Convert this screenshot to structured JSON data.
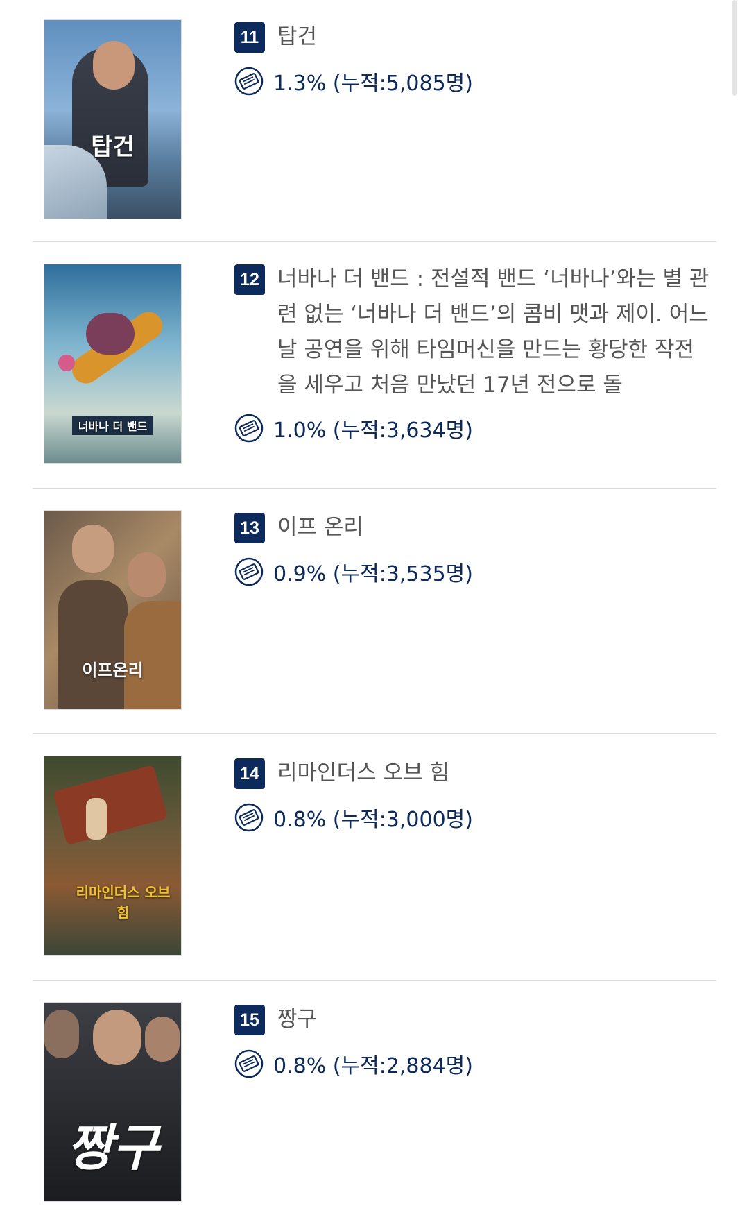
{
  "items": [
    {
      "rank": "11",
      "title": "탑건",
      "share": "1.3%",
      "cumulative": "(누적:5,085명)",
      "poster_text": "탑건"
    },
    {
      "rank": "12",
      "title": "너바나 더 밴드 : 전설적 밴드 ‘너바나’와는 별 관련 없는 ‘너바나 더 밴드’의 콤비 맷과 제이. 어느 날 공연을 위해 타임머신을 만드는 황당한 작전을 세우고 처음 만났던 17년 전으로 돌",
      "share": "1.0%",
      "cumulative": "(누적:3,634명)",
      "poster_text": "너바나 더 밴드"
    },
    {
      "rank": "13",
      "title": "이프 온리",
      "share": "0.9%",
      "cumulative": "(누적:3,535명)",
      "poster_text": "이프온리"
    },
    {
      "rank": "14",
      "title": "리마인더스 오브 힘",
      "share": "0.8%",
      "cumulative": "(누적:3,000명)",
      "poster_text": "리마인더스 오브 힘"
    },
    {
      "rank": "15",
      "title": "짱구",
      "share": "0.8%",
      "cumulative": "(누적:2,884명)",
      "poster_text": "짱구"
    }
  ],
  "icons": {
    "ticket": "ticket-icon"
  },
  "colors": {
    "rank_badge": "#0c2a5b",
    "stat_text": "#0c2a5b",
    "title_text": "#555555"
  }
}
